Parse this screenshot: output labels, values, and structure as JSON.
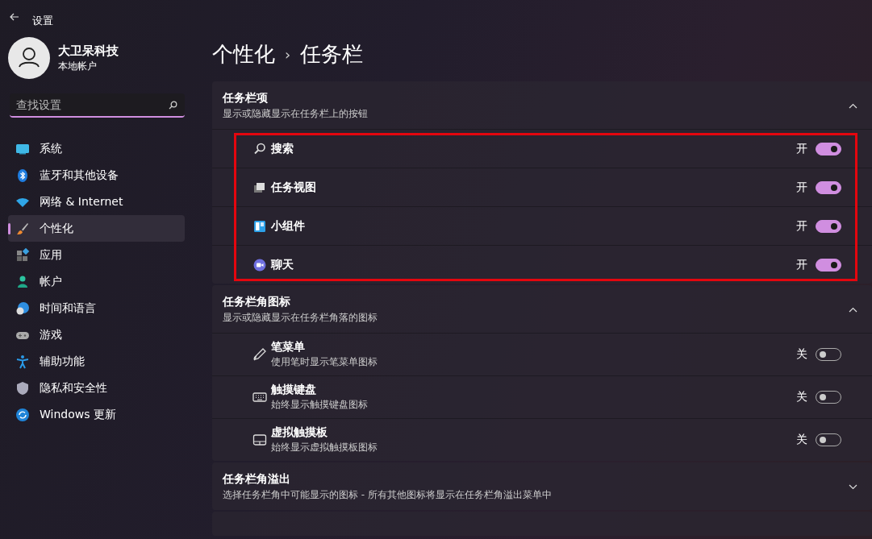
{
  "window": {
    "title": "设置"
  },
  "account": {
    "name": "大卫呆科技",
    "type": "本地帐户"
  },
  "search": {
    "placeholder": "查找设置"
  },
  "nav": [
    {
      "label": "系统",
      "kind": "system",
      "selected": false
    },
    {
      "label": "蓝牙和其他设备",
      "kind": "bluetooth",
      "selected": false
    },
    {
      "label": "网络 & Internet",
      "kind": "wifi",
      "selected": false
    },
    {
      "label": "个性化",
      "kind": "brush",
      "selected": true
    },
    {
      "label": "应用",
      "kind": "apps",
      "selected": false
    },
    {
      "label": "帐户",
      "kind": "person",
      "selected": false
    },
    {
      "label": "时间和语言",
      "kind": "globe",
      "selected": false
    },
    {
      "label": "游戏",
      "kind": "gamepad",
      "selected": false
    },
    {
      "label": "辅助功能",
      "kind": "access",
      "selected": false
    },
    {
      "label": "隐私和安全性",
      "kind": "shield",
      "selected": false
    },
    {
      "label": "Windows 更新",
      "kind": "update",
      "selected": false
    }
  ],
  "breadcrumb": [
    "个性化",
    "›",
    "任务栏"
  ],
  "sections": [
    {
      "title": "任务栏项",
      "subtitle": "显示或隐藏显示在任务栏上的按钮",
      "expanded": true,
      "highlighted": true,
      "items": [
        {
          "label": "搜索",
          "kind": "search",
          "state": "开",
          "on": true
        },
        {
          "label": "任务视图",
          "kind": "taskview",
          "state": "开",
          "on": true
        },
        {
          "label": "小组件",
          "kind": "widgets",
          "state": "开",
          "on": true
        },
        {
          "label": "聊天",
          "kind": "chat",
          "state": "开",
          "on": true
        }
      ]
    },
    {
      "title": "任务栏角图标",
      "subtitle": "显示或隐藏显示在任务栏角落的图标",
      "expanded": true,
      "items": [
        {
          "label": "笔菜单",
          "desc": "使用笔时显示笔菜单图标",
          "kind": "pen",
          "state": "关",
          "on": false
        },
        {
          "label": "触摸键盘",
          "desc": "始终显示触摸键盘图标",
          "kind": "keyboard",
          "state": "关",
          "on": false
        },
        {
          "label": "虚拟触摸板",
          "desc": "始终显示虚拟触摸板图标",
          "kind": "touchpad",
          "state": "关",
          "on": false
        }
      ]
    },
    {
      "title": "任务栏角溢出",
      "subtitle": "选择任务栏角中可能显示的图标 - 所有其他图标将显示在任务栏角溢出菜单中",
      "expanded": false
    }
  ]
}
